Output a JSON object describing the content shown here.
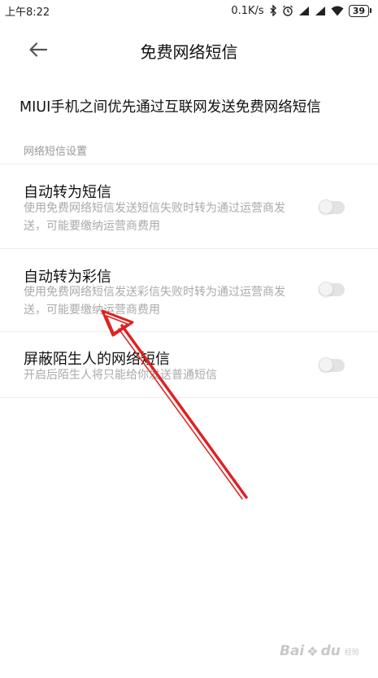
{
  "status_bar": {
    "time": "上午8:22",
    "net_speed": "0.1K/s",
    "battery": "39",
    "icons": [
      "bluetooth-icon",
      "alarm-icon",
      "signal-icon",
      "signal-icon",
      "wifi-icon",
      "battery-icon"
    ]
  },
  "header": {
    "back_icon": "arrow-left-icon",
    "title": "免费网络短信"
  },
  "intro_text": "MIUI手机之间优先通过互联网发送免费网络短信",
  "section_header": "网络短信设置",
  "settings": [
    {
      "title": "自动转为短信",
      "description": "使用免费网络短信发送短信失败时转为通过运营商发送，可能要缴纳运营商费用",
      "enabled": false
    },
    {
      "title": "自动转为彩信",
      "description": "使用免费网络短信发送彩信失败时转为通过运营商发送，可能要缴纳运营商费用",
      "enabled": false
    },
    {
      "title": "屏蔽陌生人的网络短信",
      "description": "开启后陌生人将只能给你发送普通短信",
      "enabled": false
    }
  ],
  "annotation": {
    "arrow_color": "#e02020"
  },
  "watermark": {
    "brand": "Bai",
    "brand_tail": "du",
    "sub": "经验"
  },
  "colors": {
    "divider": "#ececec",
    "secondary_text": "#aaaaaa",
    "toggle_off": "#e3e3e3"
  }
}
